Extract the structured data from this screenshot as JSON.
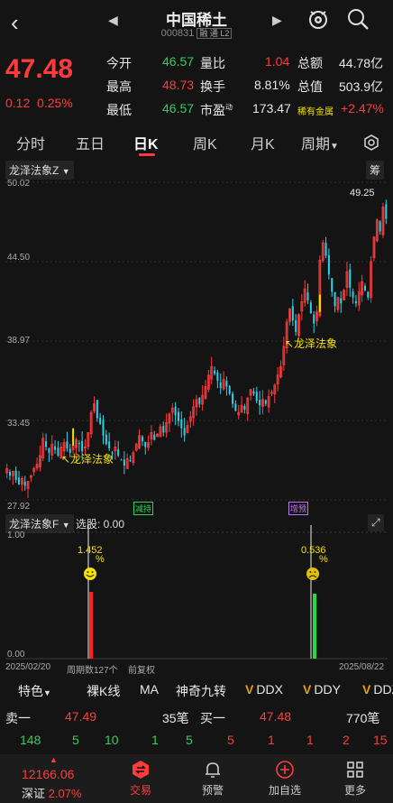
{
  "header": {
    "name": "中国稀土",
    "code": "000831",
    "tags": "融 通 L2"
  },
  "quote": {
    "price": "47.48",
    "change": "0.12",
    "change_pct": "0.25%",
    "stats": [
      {
        "label": "今开",
        "value": "46.57",
        "color": "green"
      },
      {
        "label": "量比",
        "value": "1.04",
        "color": "red"
      },
      {
        "label": "总额",
        "value": "44.78亿",
        "color": "white"
      },
      {
        "label": "最高",
        "value": "48.73",
        "color": "red"
      },
      {
        "label": "换手",
        "value": "8.81%",
        "color": "white"
      },
      {
        "label": "总值",
        "value": "503.9亿",
        "color": "white"
      },
      {
        "label": "最低",
        "value": "46.57",
        "color": "green"
      },
      {
        "label": "市盈",
        "sup": "动",
        "value": "173.47",
        "color": "white"
      },
      {
        "label": "稀有金属",
        "value": "+2.47%",
        "color": "red"
      }
    ]
  },
  "tabs": [
    "分时",
    "五日",
    "日K",
    "周K",
    "月K",
    "周期"
  ],
  "active_tab": "日K",
  "main_chart": {
    "indicator": "龙泽法象Z",
    "chip_label": "筹",
    "y_labels": [
      "50.02",
      "44.50",
      "38.97",
      "33.45",
      "27.92"
    ],
    "high_label": "49.25",
    "signal_label": "↖龙泽法象",
    "badges": [
      "减持",
      "增预"
    ]
  },
  "sub_chart": {
    "indicator": "龙泽法象F",
    "select_text": "选股: 0.00",
    "y_top": "1.00",
    "y_bottom": "0.00",
    "signal1": "1.452",
    "signal2": "0.536",
    "pct_sign": "%",
    "date_start": "2025/02/20",
    "period_count": "周期数127个",
    "adjust": "前复权",
    "date_end": "2025/08/22"
  },
  "toolbar": {
    "feature": "特色",
    "items": [
      "裸K线",
      "MA",
      "神奇九转"
    ],
    "v_items": [
      "DDX",
      "DDY",
      "DDZ"
    ]
  },
  "order_book": {
    "sell_label": "卖一",
    "sell_price": "47.49",
    "sell_qty": "35笔",
    "buy_label": "买一",
    "buy_price": "47.48",
    "buy_qty": "770笔",
    "sell_splits": [
      "148",
      "5",
      "10",
      "1",
      "5"
    ],
    "buy_splits": [
      "5",
      "1",
      "1",
      "2",
      "15"
    ]
  },
  "bottom": {
    "index_value": "12166.06",
    "index_name": "深证",
    "index_pct": "2.07%",
    "nav": [
      "交易",
      "预警",
      "加自选",
      "更多"
    ]
  },
  "chart_data": {
    "type": "candlestick",
    "ylim": [
      27.92,
      50.02
    ],
    "closes": [
      30.1,
      29.6,
      29.9,
      29.3,
      29.0,
      29.4,
      28.9,
      29.2,
      29.6,
      30.1,
      30.4,
      31.0,
      32.2,
      31.6,
      31.2,
      31.8,
      31.4,
      31.0,
      31.6,
      31.9,
      31.5,
      31.2,
      31.7,
      32.1,
      31.8,
      31.3,
      31.6,
      32.6,
      34.0,
      34.6,
      33.6,
      33.2,
      32.4,
      31.8,
      31.5,
      31.2,
      31.6,
      31.0,
      30.7,
      30.3,
      30.8,
      30.6,
      31.2,
      31.8,
      32.4,
      32.0,
      31.6,
      31.9,
      32.6,
      32.1,
      32.5,
      33.0,
      32.6,
      33.3,
      33.9,
      34.3,
      33.8,
      33.4,
      32.9,
      32.4,
      33.1,
      33.7,
      34.4,
      34.9,
      34.6,
      35.2,
      35.8,
      36.6,
      37.2,
      36.7,
      36.2,
      35.7,
      36.3,
      35.8,
      35.3,
      34.6,
      34.1,
      34.0,
      34.5,
      34.2,
      35.0,
      35.6,
      35.3,
      34.8,
      34.5,
      34.9,
      34.6,
      35.1,
      35.4,
      35.9,
      36.6,
      37.2,
      38.6,
      40.3,
      41.2,
      40.4,
      39.6,
      40.8,
      41.7,
      42.6,
      41.8,
      40.9,
      40.2,
      41.0,
      44.6,
      45.8,
      44.9,
      43.6,
      42.4,
      41.4,
      42.0,
      41.6,
      42.5,
      43.8,
      42.7,
      42.0,
      41.6,
      42.4,
      43.1,
      42.5,
      42.0,
      44.5,
      46.2,
      47.4,
      46.6,
      48.3,
      47.48
    ]
  }
}
